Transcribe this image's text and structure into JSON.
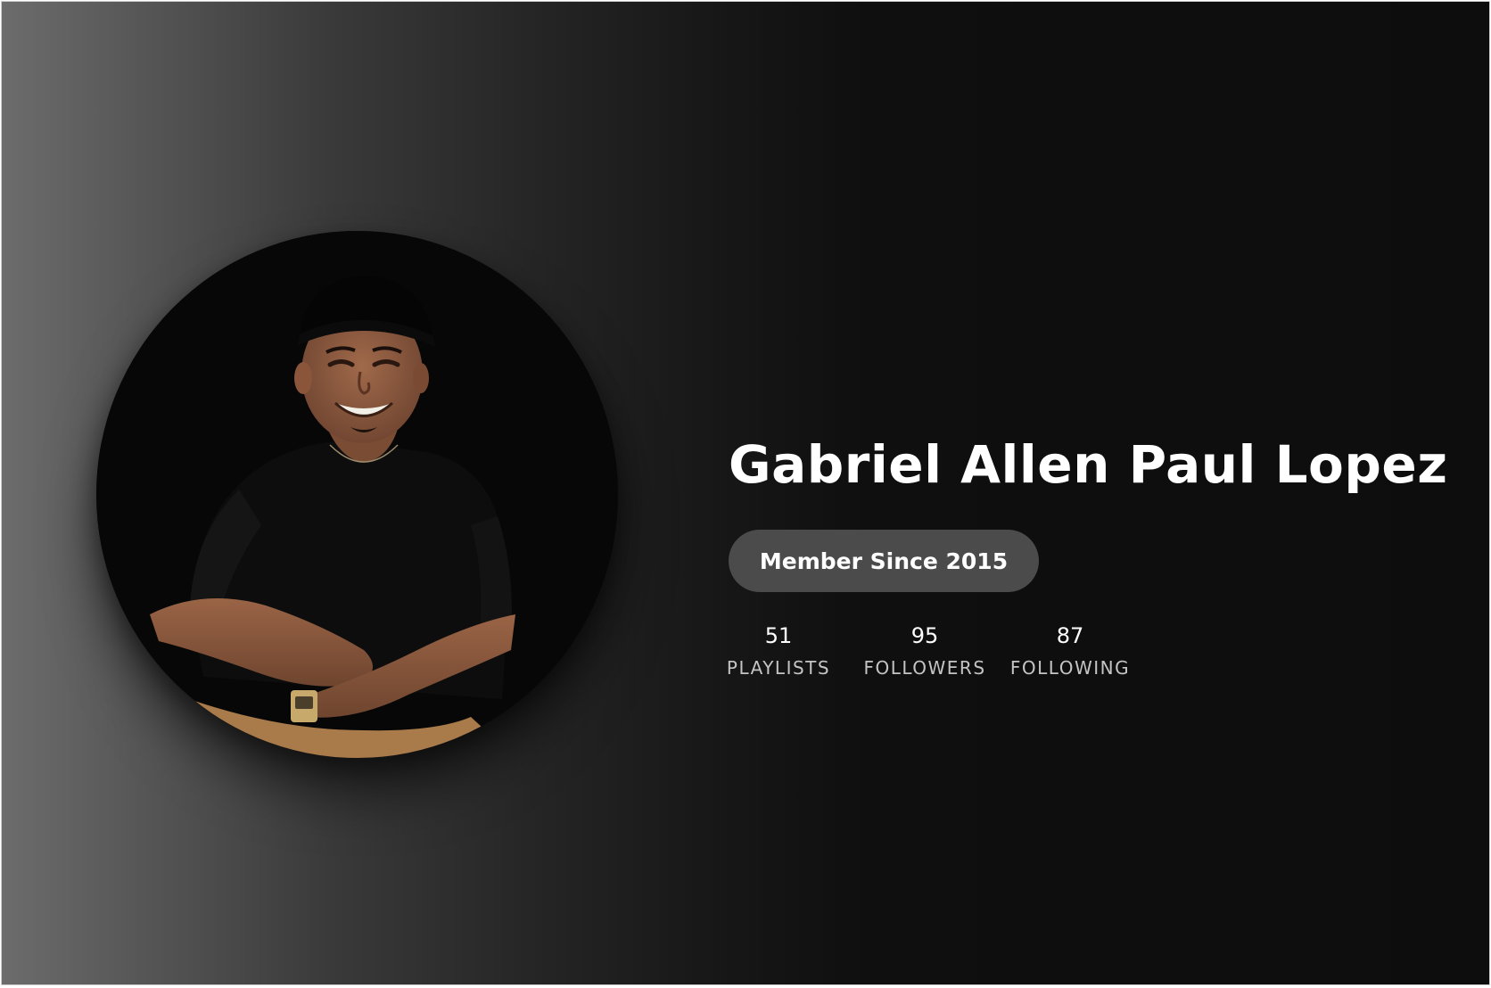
{
  "profile": {
    "name": "Gabriel Allen Paul Lopez",
    "member_since": "Member Since 2015",
    "avatar_icon": "profile-photo"
  },
  "stats": [
    {
      "value": "51",
      "label": "PLAYLISTS"
    },
    {
      "value": "95",
      "label": "FOLLOWERS"
    },
    {
      "value": "87",
      "label": "FOLLOWING"
    }
  ],
  "colors": {
    "background_dark": "#0d0d0d",
    "background_light": "#6c6c6c",
    "badge": "#4b4b4b",
    "text_primary": "#ffffff",
    "text_secondary": "#c4c4c4"
  }
}
